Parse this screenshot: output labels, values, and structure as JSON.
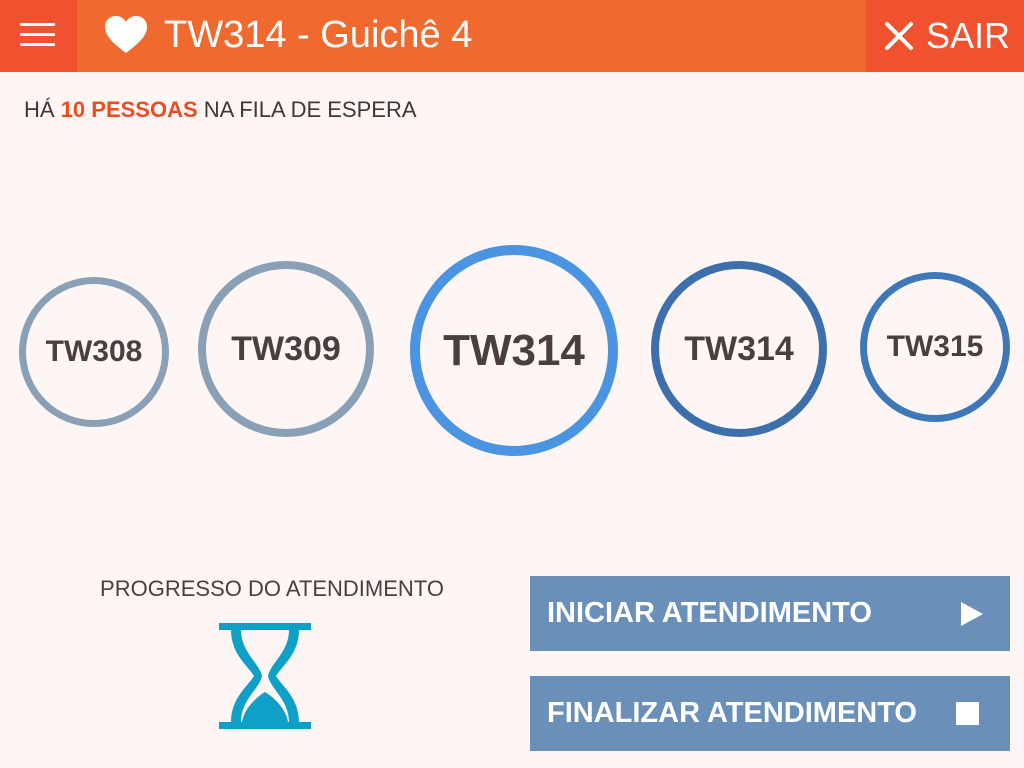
{
  "header": {
    "title": "TW314 - Guichê 4",
    "logout_label": "SAIR"
  },
  "queue": {
    "prefix": "HÁ",
    "count_text": "10 PESSOAS",
    "suffix": "NA FILA DE ESPERA"
  },
  "tickets": [
    {
      "code": "TW308"
    },
    {
      "code": "TW309"
    },
    {
      "code": "TW314"
    },
    {
      "code": "TW314"
    },
    {
      "code": "TW315"
    }
  ],
  "progress": {
    "label": "PROGRESSO DO ATENDIMENTO"
  },
  "actions": {
    "start_label": "INICIAR ATENDIMENTO",
    "finish_label": "FINALIZAR ATENDIMENTO"
  },
  "colors": {
    "header_bg": "#f06a30",
    "header_accent": "#f0512f",
    "highlight": "#ea4d22",
    "ticket_past": "#8aa0b7",
    "ticket_current": "#4a94e2",
    "ticket_next": "#3c6fac",
    "button_bg": "#6a8fb8",
    "hourglass": "#0fa0c8"
  },
  "icons": {
    "menu": "hamburger-menu-icon",
    "favorite": "heart-icon",
    "logout": "close-icon",
    "progress": "hourglass-icon",
    "start": "play-icon",
    "finish": "stop-icon"
  }
}
